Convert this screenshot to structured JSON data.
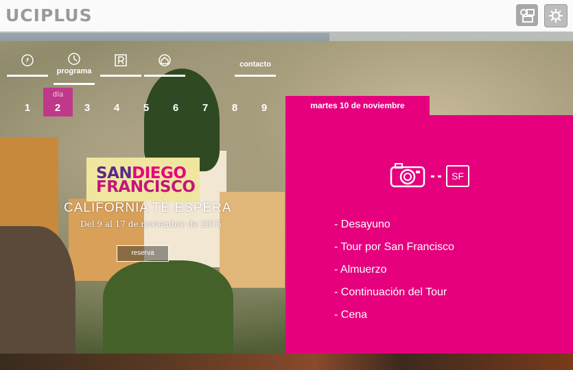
{
  "header": {
    "logo": "UCIPLUS",
    "buttons": [
      {
        "icon": "user-card-icon"
      },
      {
        "icon": "gear-icon"
      }
    ]
  },
  "nav": {
    "items": [
      {
        "icon": "compass-icon",
        "label": ""
      },
      {
        "icon": "clock-icon",
        "label": "programa"
      },
      {
        "icon": "hotel-r-icon",
        "label": ""
      },
      {
        "icon": "home-icon",
        "label": ""
      },
      {
        "icon": "",
        "label": "contacto"
      }
    ]
  },
  "days": {
    "caption": "día",
    "items": [
      "1",
      "2",
      "3",
      "4",
      "5",
      "6",
      "7",
      "8",
      "9"
    ],
    "selected": "2"
  },
  "promo": {
    "title_line1_a": "SAN",
    "title_line1_b": "DIEGO",
    "title_line2": "FRANCISCO",
    "subtitle": "CALIFORNIA TE ESPERA",
    "dates": "Del 9 al 17 de noviembre de 2015",
    "reserve_label": "reserva"
  },
  "panel": {
    "date": "martes 10 de noviembre",
    "icons": [
      "camera-icon",
      "sf-badge"
    ],
    "badge": "SF",
    "schedule": [
      "- Desayuno",
      "- Tour por San Francisco",
      "- Almuerzo",
      "- Continuación del Tour",
      "- Cena"
    ]
  },
  "colors": {
    "accent": "#e6007e",
    "day_highlight": "#c0388a",
    "promo_bg": "#f0e6a0"
  }
}
